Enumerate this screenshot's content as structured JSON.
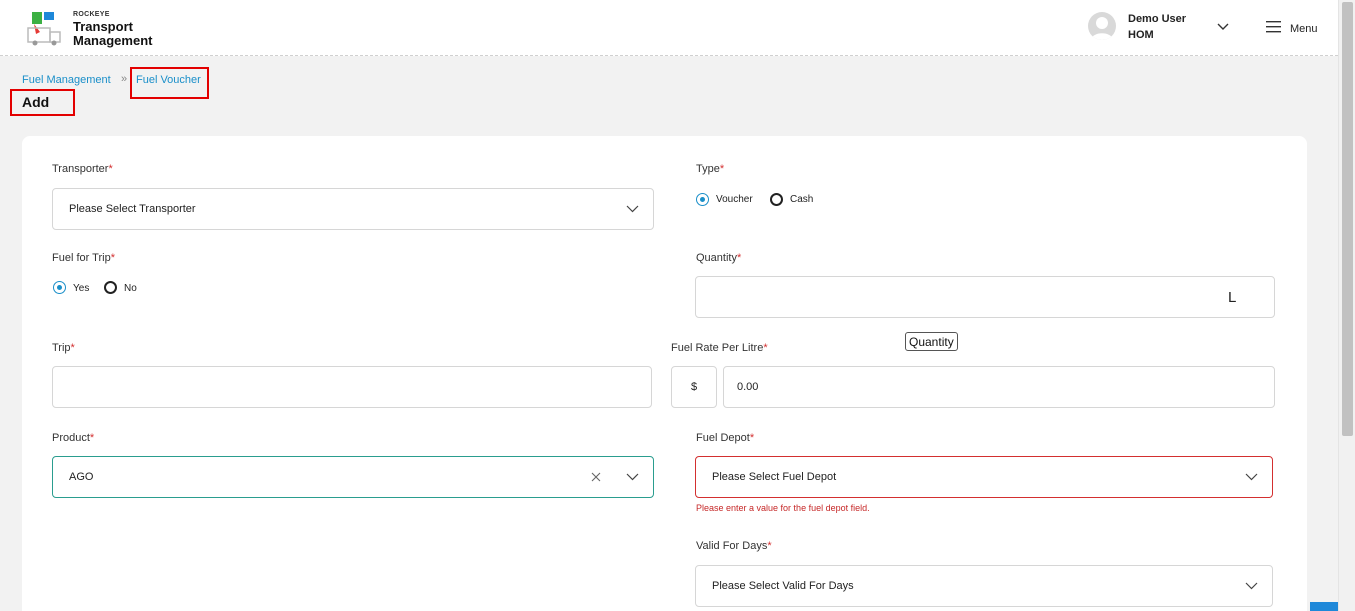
{
  "header": {
    "brand_small": "ROCKEYE",
    "brand_name": "Transport Management",
    "user_name": "Demo User",
    "user_code": "HOM",
    "menu_label": "Menu"
  },
  "breadcrumb": {
    "parent": "Fuel Management",
    "separator": "»",
    "current": "Fuel Voucher"
  },
  "page_title": "Add",
  "form": {
    "transporter": {
      "label": "Transporter",
      "required": "*",
      "value": "Please Select Transporter"
    },
    "type": {
      "label": "Type",
      "required": "*",
      "options": [
        "Voucher",
        "Cash"
      ],
      "selected": "Voucher"
    },
    "fuel_for_trip": {
      "label": "Fuel for Trip",
      "required": "*",
      "options": [
        "Yes",
        "No"
      ],
      "selected": "Yes"
    },
    "quantity": {
      "label": "Quantity",
      "required": "*",
      "value": "",
      "unit": "L",
      "tooltip": "Quantity"
    },
    "trip": {
      "label": "Trip",
      "required": "*",
      "value": ""
    },
    "fuel_rate": {
      "label": "Fuel Rate Per Litre",
      "required": "*",
      "prefix": "$",
      "value": "0.00"
    },
    "product": {
      "label": "Product",
      "required": "*",
      "value": "AGO"
    },
    "fuel_depot": {
      "label": "Fuel Depot",
      "required": "*",
      "value": "Please Select Fuel Depot",
      "error": "Please enter a value for the fuel depot field."
    },
    "valid_for_days": {
      "label": "Valid For Days",
      "required": "*",
      "value": "Please Select Valid For Days"
    }
  },
  "colors": {
    "accent": "#1a8fc9",
    "error": "#d32f2f",
    "focus_border": "#2a9d8f",
    "highlight": "#e30000"
  }
}
